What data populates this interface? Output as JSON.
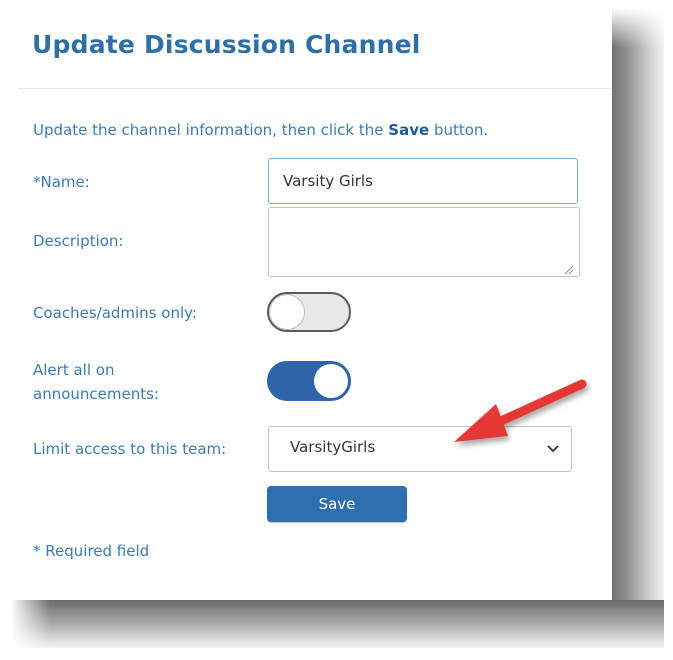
{
  "dialog": {
    "title": "Update Discussion Channel",
    "instructions_prefix": "Update the channel information, then click the ",
    "instructions_bold": "Save",
    "instructions_suffix": " button."
  },
  "form": {
    "name_label": "*Name:",
    "name_value": "Varsity Girls",
    "description_label": "Description:",
    "description_value": "",
    "coaches_only_label": "Coaches/admins only:",
    "coaches_only_on": false,
    "alert_label_line1": "Alert all on",
    "alert_label_line2": "announcements:",
    "alert_on": true,
    "limit_label": "Limit access to this team:",
    "limit_value": "VarsityGirls",
    "save_label": "Save",
    "required_note": "* Required field"
  },
  "icons": {
    "dropdown": "chevron-down-icon",
    "annotation": "red-arrow-icon",
    "resize": "resize-grip-icon"
  },
  "colors": {
    "accent": "#2f6fb0",
    "label": "#3a7cb5",
    "toggle_on": "#2f64a8",
    "arrow": "#e53935"
  }
}
